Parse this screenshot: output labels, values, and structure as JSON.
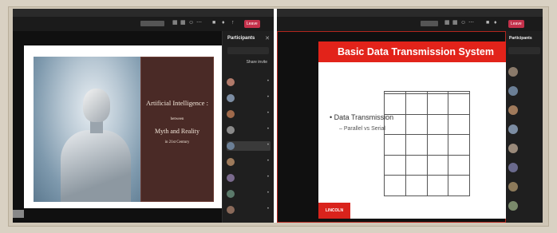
{
  "left_window": {
    "title_text": "",
    "leave_label": "Leave",
    "panel": {
      "title": "Participants",
      "close_glyph": "✕",
      "search_placeholder": "",
      "share_label": "Share invite",
      "section_in_meeting": "",
      "section_others": "",
      "items": [
        {
          "name": "",
          "sub": "",
          "color": "#b17a6a",
          "selected": false
        },
        {
          "name": "",
          "sub": "",
          "color": "#7c8da3",
          "selected": false
        },
        {
          "name": "",
          "sub": "",
          "color": "#a06a4b",
          "selected": false
        },
        {
          "name": "",
          "sub": "",
          "color": "#8a8a8a",
          "selected": false
        },
        {
          "name": "",
          "sub": "",
          "color": "#6b7f96",
          "selected": true
        },
        {
          "name": "",
          "sub": "",
          "color": "#9d7a5b",
          "selected": false
        },
        {
          "name": "",
          "sub": "",
          "color": "#7a6a8d",
          "selected": false
        },
        {
          "name": "",
          "sub": "",
          "color": "#5b7a6b",
          "selected": false
        },
        {
          "name": "",
          "sub": "",
          "color": "#8a6a5a",
          "selected": false
        }
      ]
    },
    "slide": {
      "title_line1": "Artificial Intelligence :",
      "between_word": "between",
      "title_line2": "Myth and Reality",
      "century": "in 21st Century",
      "author": "",
      "affiliation": ""
    }
  },
  "right_window": {
    "title_text": "",
    "leave_label": "Leave",
    "panel": {
      "title": "Participants",
      "items": [
        {
          "color": "#8a7a6a"
        },
        {
          "color": "#6b7f96"
        },
        {
          "color": "#a07a5b"
        },
        {
          "color": "#7c8da3"
        },
        {
          "color": "#9a8a7a"
        },
        {
          "color": "#6a6a8d"
        },
        {
          "color": "#8d7a5a"
        },
        {
          "color": "#7a8a6b"
        }
      ]
    },
    "slide": {
      "header": "Basic Data Transmission System",
      "bullet1": "• Data Transmission",
      "bullet2": "– Parallel vs Serial",
      "table_headers": [
        "",
        "",
        "",
        ""
      ],
      "table_rows": [
        [
          "",
          "",
          "",
          ""
        ],
        [
          "",
          "",
          "",
          ""
        ],
        [
          "",
          "",
          "",
          ""
        ],
        [
          "",
          "",
          "",
          ""
        ],
        [
          "",
          "",
          "",
          ""
        ]
      ],
      "logo_text": "LINCOLN",
      "footer": ""
    },
    "presenter_name": ""
  },
  "colors": {
    "leave_red": "#c4314b",
    "slide_header_red": "#e2231a",
    "title_box_brown": "#4a2a26"
  }
}
